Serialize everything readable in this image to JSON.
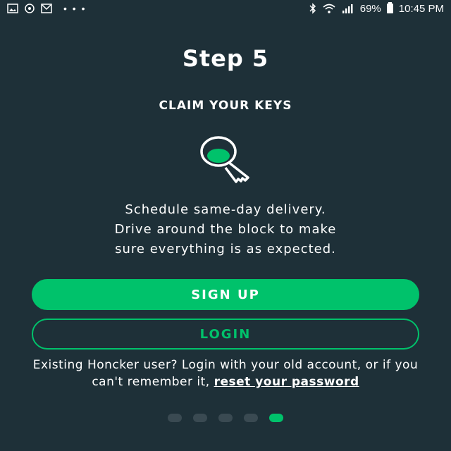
{
  "status_bar": {
    "left_icons": [
      "image-icon",
      "sync-icon",
      "gmail-icon"
    ],
    "overflow": "• • •",
    "battery_percent": "69%",
    "time": "10:45 PM"
  },
  "onboarding": {
    "title": "Step 5",
    "subtitle": "CLAIM YOUR KEYS",
    "icon": "key-icon",
    "description_lines": [
      "Schedule same-day delivery.",
      "Drive around the block to make",
      "sure everything is as expected."
    ]
  },
  "actions": {
    "signup_label": "SIGN UP",
    "login_label": "LOGIN"
  },
  "footer": {
    "text": "Existing Honcker user? Login with your old account, or if you can't remember it, ",
    "link_label": "reset your password"
  },
  "pager": {
    "total": 5,
    "active_index": 4
  },
  "colors": {
    "background": "#1e3038",
    "accent": "#00c26b",
    "inactive_dot": "#3a4a52"
  }
}
